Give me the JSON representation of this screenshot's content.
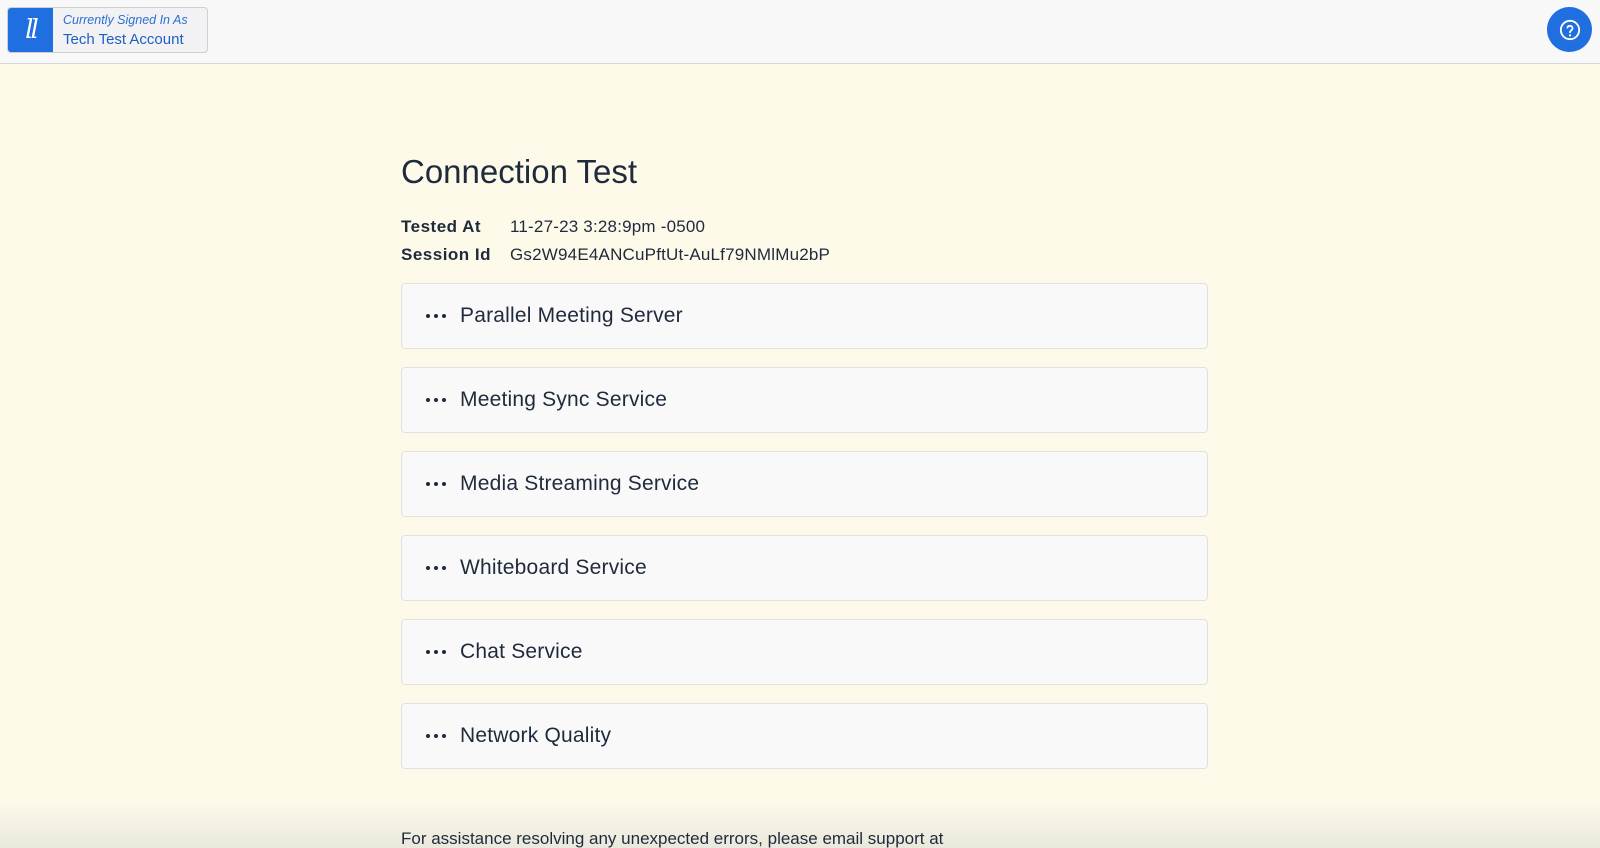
{
  "header": {
    "logo_text": "ll",
    "signed_in_label": "Currently Signed In As",
    "account_name": "Tech Test Account",
    "help_icon": "question-circle-icon"
  },
  "main": {
    "title": "Connection Test",
    "meta": [
      {
        "key": "Tested At",
        "value": "11-27-23 3:28:9pm -0500"
      },
      {
        "key": "Session Id",
        "value": "Gs2W94E4ANCuPftUt-AuLf79NMlMu2bP"
      }
    ],
    "tests": [
      {
        "label": "Parallel Meeting Server",
        "status_icon": "ellipsis-icon"
      },
      {
        "label": "Meeting Sync Service",
        "status_icon": "ellipsis-icon"
      },
      {
        "label": "Media Streaming Service",
        "status_icon": "ellipsis-icon"
      },
      {
        "label": "Whiteboard Service",
        "status_icon": "ellipsis-icon"
      },
      {
        "label": "Chat Service",
        "status_icon": "ellipsis-icon"
      },
      {
        "label": "Network Quality",
        "status_icon": "ellipsis-icon"
      }
    ],
    "footer_note": "For assistance resolving any unexpected errors, please email support at"
  },
  "colors": {
    "accent": "#1f6fe0",
    "background": "#fdfaea",
    "text": "#1f2a3c"
  }
}
